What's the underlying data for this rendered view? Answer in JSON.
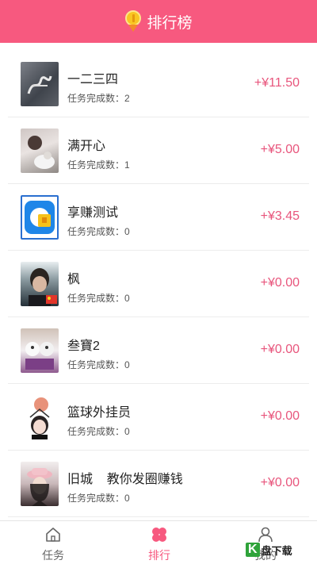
{
  "header": {
    "title": "排行榜",
    "icon": "medal-icon"
  },
  "ranking": [
    {
      "name": "一二三四",
      "tasks_label": "任务完成数：2",
      "reward": "+¥11.50"
    },
    {
      "name": "满开心",
      "tasks_label": "任务完成数：1",
      "reward": "+¥5.00"
    },
    {
      "name": "享赚测试",
      "tasks_label": "任务完成数：0",
      "reward": "+¥3.45"
    },
    {
      "name": "枫",
      "tasks_label": "任务完成数：0",
      "reward": "+¥0.00"
    },
    {
      "name": "叁寶2",
      "tasks_label": "任务完成数：0",
      "reward": "+¥0.00"
    },
    {
      "name": "篮球外挂员",
      "tasks_label": "任务完成数：0",
      "reward": "+¥0.00"
    },
    {
      "name": "旧城    教你发圈赚钱",
      "tasks_label": "任务完成数：0",
      "reward": "+¥0.00"
    }
  ],
  "tabbar": {
    "tasks_label": "任务",
    "ranking_label": "排行",
    "profile_label": "我的",
    "active": "ranking"
  },
  "colors": {
    "accent": "#f7597f",
    "reward": "#e8557c"
  },
  "watermark": {
    "text": "盘下载",
    "badge": "K"
  }
}
